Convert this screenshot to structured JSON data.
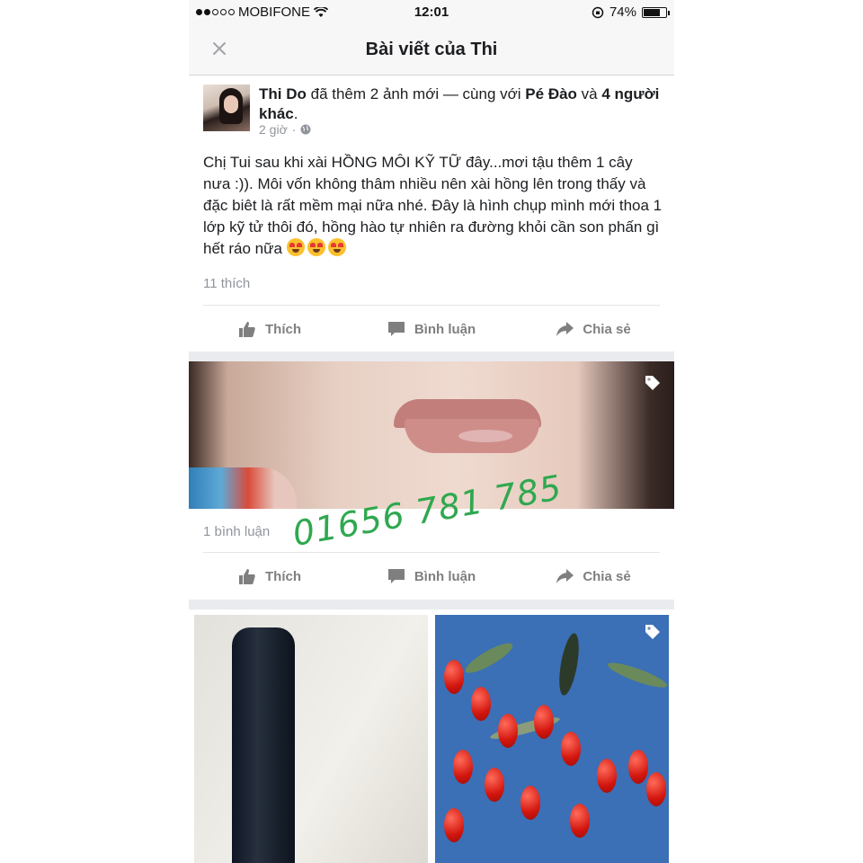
{
  "status_bar": {
    "carrier": "MOBIFONE",
    "time": "12:01",
    "battery": "74%",
    "battery_level": 0.74,
    "signal_bars_filled": 2,
    "signal_bars_total": 5
  },
  "nav": {
    "title": "Bài viết của Thi",
    "close_icon": "close-icon"
  },
  "post": {
    "author": "Thi Do",
    "action_text": " đã thêm 2 ảnh mới — cùng với ",
    "tagged": "Pé Đào",
    "and_text": " và ",
    "others": "4 người khác",
    "period": ".",
    "time": "2 giờ",
    "separator": "·",
    "body": "Chị Tui sau khi xài HỒNG MÔI KỸ TỮ đây...mơi tậu thêm 1 cây nưa :)). Môi vốn không thâm nhiều nên xài hồng lên trong thấy và đặc biêt là rất mềm mại nữa nhé. Đây là hình chụp mình mới thoa 1 lớp kỹ tử thôi đó, hồng hào tự nhiên ra đường khỏi cần son phấn gì hết ráo nữa",
    "emoji": "heart-eyes-emoji",
    "likes": "11 thích"
  },
  "actions": {
    "like": "Thích",
    "comment": "Bình luận",
    "share": "Chia sẻ"
  },
  "photo1": {
    "comments": "1 bình luận"
  },
  "overlay": {
    "phone": "01656 781 785"
  },
  "colors": {
    "background": "#e9ebee",
    "card": "#ffffff",
    "action_gray": "#7f7f7f",
    "meta_gray": "#90949c",
    "overlay_green": "#2fa84f"
  }
}
